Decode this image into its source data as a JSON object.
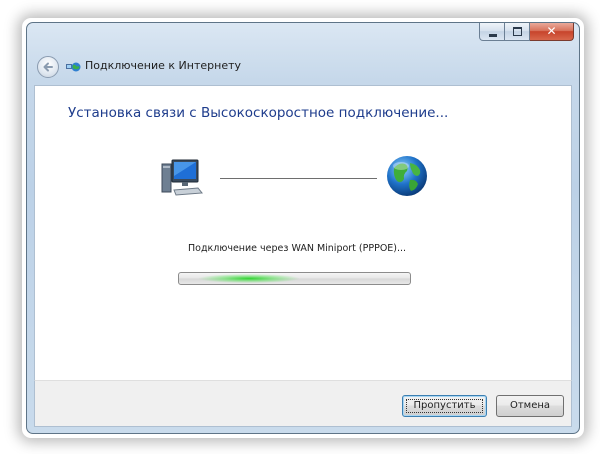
{
  "window": {
    "title": "Подключение к Интернету",
    "close_glyph": "✕"
  },
  "content": {
    "heading": "Установка связи с Высокоскоростное подключение...",
    "status": "Подключение через WAN Miniport (PPPOE)...",
    "progress": {
      "mode": "indeterminate",
      "glow_color": "#2ed22e"
    }
  },
  "buttons": {
    "skip": "Пропустить",
    "cancel": "Отмена"
  },
  "icons": {
    "back": "back-arrow-icon",
    "title": "network-globe-icon",
    "computer": "computer-icon",
    "internet": "globe-icon"
  }
}
